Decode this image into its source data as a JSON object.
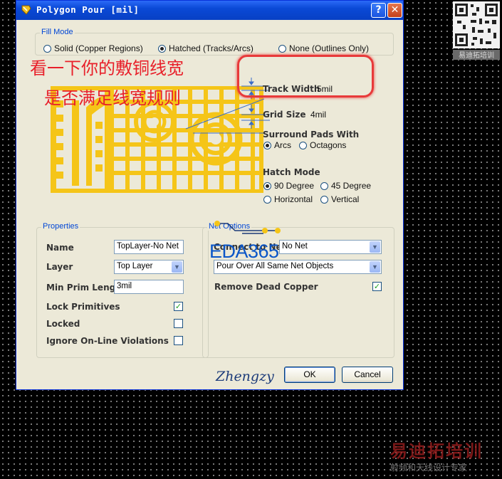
{
  "window": {
    "title": "Polygon Pour [mil]",
    "help_label": "?",
    "close_label": "✕"
  },
  "fill_mode": {
    "group_label": "Fill Mode",
    "options": [
      {
        "label": "Solid (Copper Regions)",
        "selected": false
      },
      {
        "label": "Hatched (Tracks/Arcs)",
        "selected": true
      },
      {
        "label": "None (Outlines Only)",
        "selected": false
      }
    ]
  },
  "preview": {
    "track_width_label": "Track Width",
    "track_width_value": "5mil",
    "grid_size_label": "Grid Size",
    "grid_size_value": "4mil",
    "surround_label": "Surround Pads With",
    "surround_options": [
      {
        "label": "Arcs",
        "selected": true
      },
      {
        "label": "Octagons",
        "selected": false
      }
    ],
    "hatch_label": "Hatch Mode",
    "hatch_options": [
      {
        "label": "90 Degree",
        "selected": true
      },
      {
        "label": "45 Degree",
        "selected": false
      },
      {
        "label": "Horizontal",
        "selected": false
      },
      {
        "label": "Vertical",
        "selected": false
      }
    ]
  },
  "properties": {
    "group_label": "Properties",
    "name_label": "Name",
    "name_value": "TopLayer-No Net",
    "layer_label": "Layer",
    "layer_value": "Top Layer",
    "min_prim_label": "Min Prim Length",
    "min_prim_value": "3mil",
    "lock_primitives_label": "Lock Primitives",
    "lock_primitives_checked": true,
    "locked_label": "Locked",
    "locked_checked": false,
    "ignore_label": "Ignore On-Line Violations",
    "ignore_checked": false
  },
  "net_options": {
    "group_label": "Net Options",
    "connect_label": "Connect to Net",
    "connect_value": "No Net",
    "pour_value": "Pour Over All Same Net Objects",
    "remove_dead_label": "Remove Dead Copper",
    "remove_dead_checked": true
  },
  "buttons": {
    "ok": "OK",
    "cancel": "Cancel"
  },
  "annotations": {
    "line1": "看一下你的敷铜线宽",
    "line2": "是否满足线宽规则",
    "logo": "EDA365",
    "signature": "Zhengzy"
  },
  "watermark": {
    "line1": "易迪拓培训",
    "line2": "射频和天线设计专家",
    "qr_caption": "易迪拓培训"
  },
  "colors": {
    "titlebar": "#0a49d6",
    "dialog_bg": "#ece9d8",
    "copper": "#f5c518",
    "annotation_red": "#e8202a",
    "logo_blue": "#0b56c8"
  }
}
